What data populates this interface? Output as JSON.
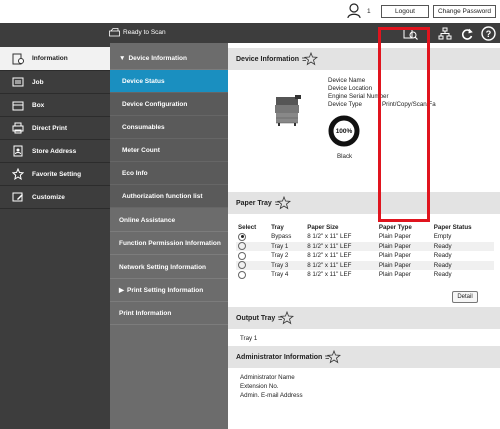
{
  "topbar": {
    "user_count": "1",
    "logout_label": "Logout",
    "change_password_label": "Change Password"
  },
  "header": {
    "status_text": "Ready to Scan"
  },
  "left_nav": [
    {
      "label": "Information",
      "icon": "info-icon"
    },
    {
      "label": "Job",
      "icon": "job-icon"
    },
    {
      "label": "Box",
      "icon": "box-icon"
    },
    {
      "label": "Direct Print",
      "icon": "printer-icon"
    },
    {
      "label": "Store Address",
      "icon": "address-book-icon"
    },
    {
      "label": "Favorite Setting",
      "icon": "star-icon"
    },
    {
      "label": "Customize",
      "icon": "customize-icon"
    }
  ],
  "mid_nav": {
    "device_information": "Device Information",
    "device_status": "Device Status",
    "device_configuration": "Device Configuration",
    "consumables": "Consumables",
    "meter_count": "Meter Count",
    "eco_info": "Eco Info",
    "authorization_function_list": "Authorization function list",
    "online_assistance": "Online Assistance",
    "function_permission_information": "Function Permission Information",
    "network_setting_information": "Network Setting Information",
    "print_setting_information": "Print Setting Information",
    "print_information": "Print Information"
  },
  "device_info": {
    "title": "Device Information",
    "fields": [
      {
        "label": "Device Name",
        "value": ""
      },
      {
        "label": "Device Location",
        "value": ""
      },
      {
        "label": "Engine Serial Number",
        "value": ""
      },
      {
        "label": "Device Type",
        "value": "Print/Copy/Scan/Fa"
      }
    ],
    "toner_percent": "100%",
    "toner_fill": 1.0,
    "toner_color": "Black"
  },
  "paper_tray": {
    "title": "Paper Tray",
    "columns": [
      "Select",
      "Tray",
      "Paper Size",
      "Paper Type",
      "Paper Status"
    ],
    "rows": [
      {
        "selected": true,
        "tray": "Bypass",
        "size": "8 1/2\" x 11\" LEF",
        "type": "Plain Paper",
        "status": "Empty"
      },
      {
        "selected": false,
        "tray": "Tray 1",
        "size": "8 1/2\" x 11\" LEF",
        "type": "Plain Paper",
        "status": "Ready"
      },
      {
        "selected": false,
        "tray": "Tray 2",
        "size": "8 1/2\" x 11\" LEF",
        "type": "Plain Paper",
        "status": "Ready"
      },
      {
        "selected": false,
        "tray": "Tray 3",
        "size": "8 1/2\" x 11\" LEF",
        "type": "Plain Paper",
        "status": "Ready"
      },
      {
        "selected": false,
        "tray": "Tray 4",
        "size": "8 1/2\" x 11\" LEF",
        "type": "Plain Paper",
        "status": "Ready"
      }
    ],
    "detail_label": "Detail"
  },
  "output_tray": {
    "title": "Output Tray",
    "value": "Tray 1"
  },
  "admin_info": {
    "title": "Administrator Information",
    "fields": [
      "Administrator Name",
      "Extension No.",
      "Admin. E-mail Address"
    ]
  },
  "colors": {
    "dark_gray": "#3d3d3d",
    "mid_gray": "#6c6c6c",
    "selected_blue": "#1a8fc0",
    "highlight_red": "#e0141e"
  }
}
